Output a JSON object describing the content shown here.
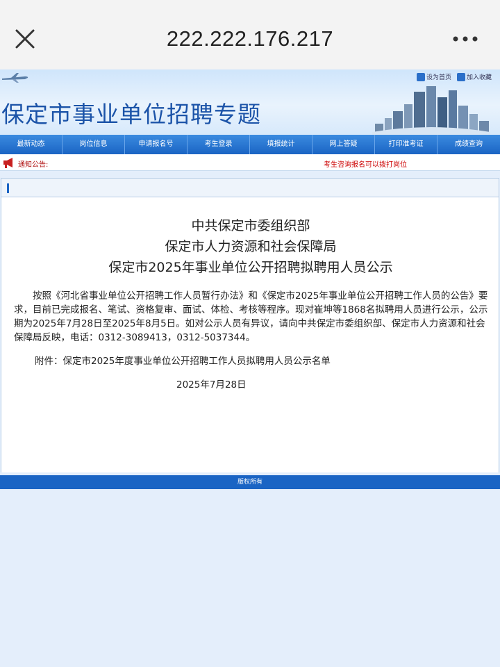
{
  "browser": {
    "url": "222.222.176.217",
    "close_icon": "close-icon",
    "more_icon": "more-dots-icon"
  },
  "header": {
    "title": "保定市事业单位招聘专题",
    "set_home": "设为首页",
    "add_favorite": "加入收藏"
  },
  "nav": {
    "items": [
      "最新动态",
      "岗位信息",
      "申请报名号",
      "考生登录",
      "填报统计",
      "网上答疑",
      "打印准考证",
      "成绩查询"
    ]
  },
  "notice": {
    "label": "通知公告:",
    "text": "考生咨询报名可以拨打岗位"
  },
  "article": {
    "heading_1": "中共保定市委组织部",
    "heading_2": "保定市人力资源和社会保障局",
    "heading_3": "保定市2025年事业单位公开招聘拟聘用人员公示",
    "body": "按照《河北省事业单位公开招聘工作人员暂行办法》和《保定市2025年事业单位公开招聘工作人员的公告》要求，目前已完成报名、笔试、资格复审、面试、体检、考核等程序。现对崔坤等1868名拟聘用人员进行公示，公示期为2025年7月28日至2025年8月5日。如对公示人员有异议，请向中共保定市委组织部、保定市人力资源和社会保障局反映，电话：0312-3089413，0312-5037344。",
    "attachment": "附件：保定市2025年度事业单位公开招聘工作人员拟聘用人员公示名单",
    "date": "2025年7月28日"
  },
  "footer": {
    "text": "版权所有"
  },
  "colors": {
    "nav_blue": "#1a64c4",
    "title_blue": "#1b53a8",
    "notice_red": "#c00000"
  }
}
